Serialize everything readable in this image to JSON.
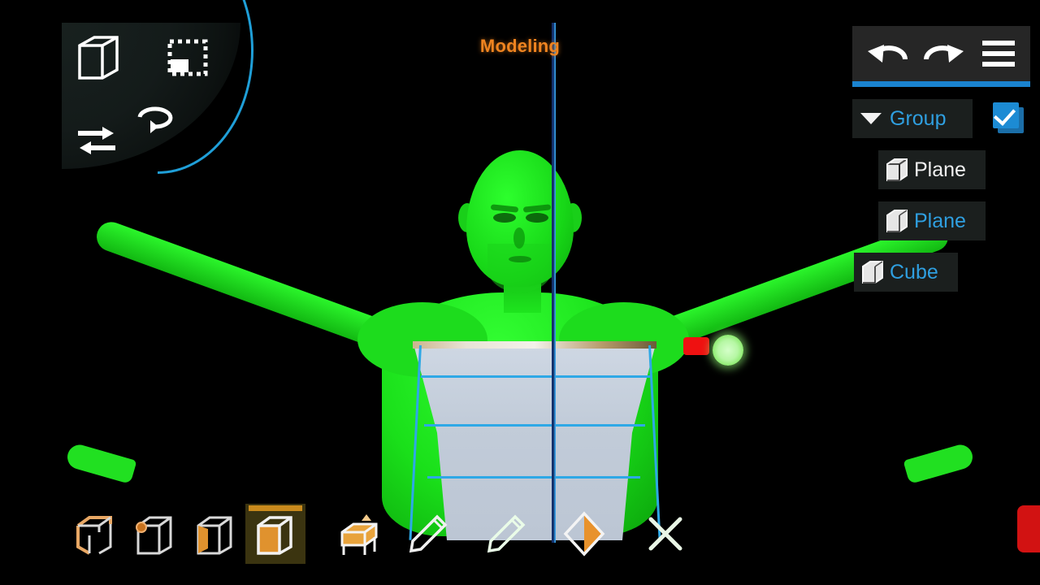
{
  "app": {
    "mode_title": "Modeling",
    "accent_orange": "#ef8420",
    "accent_blue": "#2f9fe0",
    "panel_bg": "#1b1f1e",
    "toolbar_bg": "#262626",
    "underline_blue": "#1a83cf",
    "model_green": "#1fe01f",
    "mesh_grey": "#c5cfdd",
    "handle_red": "#ef1111",
    "handle_green": "#9ef07f"
  },
  "radial_menu": {
    "name": "radial-tool-wheel",
    "tools": [
      {
        "id": "object-mode",
        "icon": "cube-icon",
        "label": "Object"
      },
      {
        "id": "select-tool",
        "icon": "marquee-select-icon",
        "label": "Select"
      },
      {
        "id": "rotate-tool",
        "icon": "rotate-icon",
        "label": "Rotate"
      },
      {
        "id": "move-tool",
        "icon": "move-arrows-icon",
        "label": "Move"
      }
    ]
  },
  "top_toolbar": {
    "buttons": [
      {
        "id": "undo",
        "icon": "undo-icon",
        "label": "Undo"
      },
      {
        "id": "redo",
        "icon": "redo-icon",
        "label": "Redo"
      },
      {
        "id": "menu",
        "icon": "hamburger-menu-icon",
        "label": "Menu"
      }
    ]
  },
  "outliner": {
    "group": {
      "label": "Group",
      "expanded": true,
      "caret_icon": "chevron-down-icon",
      "checkbox_checked": true
    },
    "items": [
      {
        "label": "Plane",
        "icon": "cube-icon",
        "selected": false,
        "indent": 1
      },
      {
        "label": "Plane",
        "icon": "cube-icon",
        "selected": true,
        "indent": 1
      },
      {
        "label": "Cube",
        "icon": "cube-icon",
        "selected": true,
        "indent": 0
      }
    ]
  },
  "bottom_toolbar": {
    "tools": [
      {
        "id": "edge-select",
        "icon": "cube-edge-icon",
        "label": "Edge",
        "active": false
      },
      {
        "id": "vertex-select",
        "icon": "cube-vertex-icon",
        "label": "Vertex",
        "active": false
      },
      {
        "id": "face-select",
        "icon": "cube-face-icon",
        "label": "Face",
        "active": false
      },
      {
        "id": "object-select",
        "icon": "cube-solid-icon",
        "label": "Object",
        "active": true
      },
      {
        "id": "extrude",
        "icon": "extrude-icon",
        "label": "Extrude",
        "active": false
      },
      {
        "id": "draw",
        "icon": "pencil-icon",
        "label": "Draw",
        "active": false
      },
      {
        "id": "draw-green",
        "icon": "pencil-green-icon",
        "label": "Paint",
        "active": false
      },
      {
        "id": "symmetry",
        "icon": "diamond-mirror-icon",
        "label": "Symmetry",
        "active": false
      },
      {
        "id": "delete",
        "icon": "close-x-icon",
        "label": "Delete",
        "active": false
      }
    ]
  },
  "floating": {
    "record_button": {
      "id": "record",
      "label": "Record"
    }
  },
  "manipulator": {
    "handles": [
      {
        "id": "scale-handle",
        "shape": "rect",
        "color": "#ef1111"
      },
      {
        "id": "move-handle",
        "shape": "circle",
        "color": "#9ef07f"
      }
    ]
  }
}
